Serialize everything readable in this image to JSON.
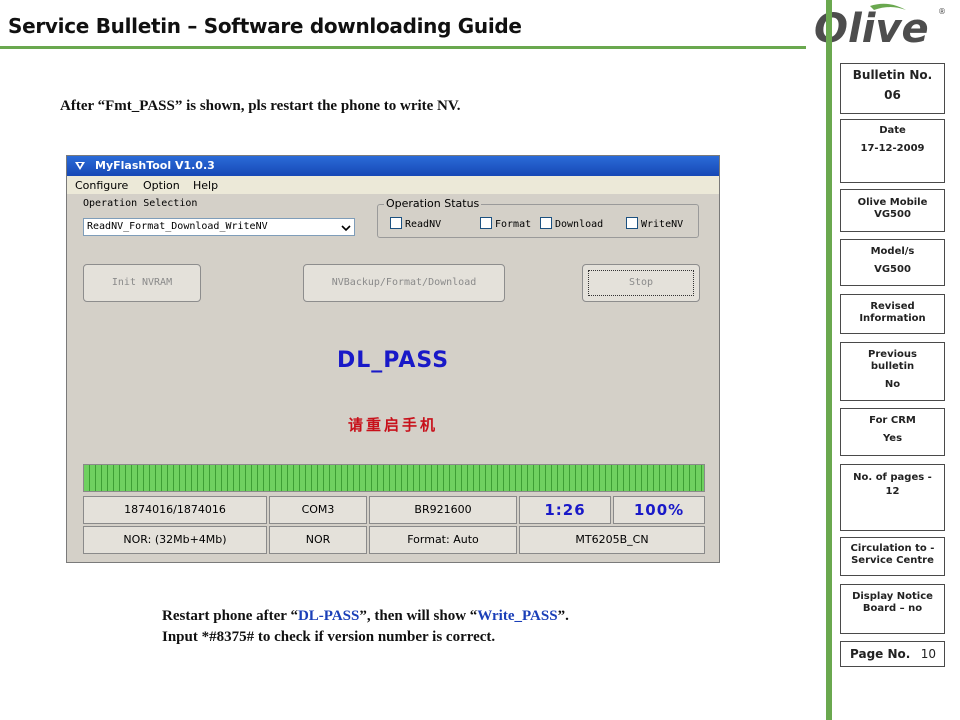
{
  "header": {
    "title": "Service Bulletin – Software downloading Guide",
    "logo_text": "Olive",
    "accent_color": "#6aa84f"
  },
  "intro": {
    "before": "After “Fmt_PASS” is shown, pls restart the phone to write NV."
  },
  "sidebar": {
    "bulletin_label": "Bulletin No.",
    "bulletin_value": "06",
    "date_label": "Date",
    "date_value": "17-12-2009",
    "device_label": "Olive Mobile",
    "device_value": "VG500",
    "model_label": "Model/s",
    "model_value": "VG500",
    "revised_label": "Revised Information",
    "previous_label": "Previous bulletin",
    "previous_value": "No",
    "crm_label": "For CRM",
    "crm_value": "Yes",
    "pages_label": "No. of pages -",
    "pages_value": "12",
    "circulation_label": "Circulation to - Service Centre",
    "notice_label": "Display Notice Board – no",
    "page_label": "Page No.",
    "page_value": "10"
  },
  "tool": {
    "title": "MyFlashTool V1.0.3",
    "menu": [
      "Configure",
      "Option",
      "Help"
    ],
    "op_selection_label": "Operation Selection",
    "op_selection_value": "ReadNV_Format_Download_WriteNV",
    "op_status_label": "Operation Status",
    "checkboxes": [
      "ReadNV",
      "Format",
      "Download",
      "WriteNV"
    ],
    "buttons": {
      "init": "Init NVRAM",
      "backup": "NVBackup/Format/Download",
      "stop": "Stop"
    },
    "result_text": "DL_PASS",
    "restart_text": "请重启手机",
    "progress": 1.0,
    "status_row1": [
      "1874016/1874016",
      "COM3",
      "BR921600",
      "1:26",
      "100%"
    ],
    "status_row2": [
      "NOR: (32Mb+4Mb)",
      "NOR",
      "Format: Auto",
      "MT6205B_CN"
    ]
  },
  "instructions": {
    "line1_prefix": "Restart phone after “",
    "line1_dl": "DL-PASS",
    "line1_mid": "”, then will show “",
    "line1_write": "Write_PASS",
    "line1_suffix": "”.",
    "line2": "Input *#8375# to check if version number is correct."
  }
}
